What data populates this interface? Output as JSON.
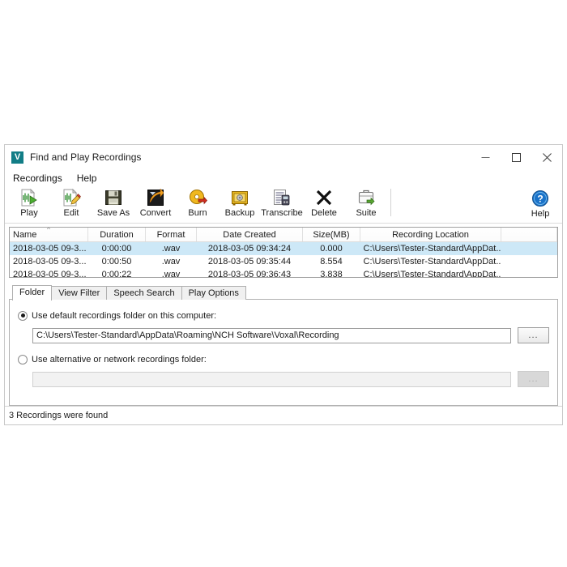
{
  "window": {
    "title": "Find and Play Recordings",
    "app_icon": "voxal-v-icon",
    "icon_letter": "V",
    "icon_color": "#127d86",
    "controls": {
      "minimize": "minimize-icon",
      "maximize": "maximize-icon",
      "close": "close-icon"
    }
  },
  "menubar": {
    "items": [
      {
        "label": "Recordings"
      },
      {
        "label": "Help"
      }
    ]
  },
  "toolbar": {
    "buttons": [
      {
        "label": "Play",
        "icon": "play-waveform-icon"
      },
      {
        "label": "Edit",
        "icon": "edit-waveform-icon"
      },
      {
        "label": "Save As",
        "icon": "floppy-disk-icon"
      },
      {
        "label": "Convert",
        "icon": "convert-arrow-icon"
      },
      {
        "label": "Burn",
        "icon": "burn-disc-icon"
      },
      {
        "label": "Backup",
        "icon": "safe-vault-icon"
      },
      {
        "label": "Transcribe",
        "icon": "transcribe-icon"
      },
      {
        "label": "Delete",
        "icon": "delete-x-icon"
      },
      {
        "label": "Suite",
        "icon": "suite-briefcase-icon"
      }
    ],
    "help": {
      "label": "Help",
      "icon": "help-question-icon"
    }
  },
  "recordings_table": {
    "columns": [
      "Name",
      "Duration",
      "Format",
      "Date Created",
      "Size(MB)",
      "Recording Location"
    ],
    "sort_column": "Name",
    "sort_direction": "ascending",
    "sort_glyph": "▲",
    "rows": [
      {
        "name": "2018-03-05 09-3...",
        "duration": "0:00:00",
        "format": ".wav",
        "date_created": "2018-03-05 09:34:24",
        "size_mb": "0.000",
        "location": "C:\\Users\\Tester-Standard\\AppDat...",
        "selected": true
      },
      {
        "name": "2018-03-05 09-3...",
        "duration": "0:00:50",
        "format": ".wav",
        "date_created": "2018-03-05 09:35:44",
        "size_mb": "8.554",
        "location": "C:\\Users\\Tester-Standard\\AppDat...",
        "selected": false
      },
      {
        "name": "2018-03-05 09-3...",
        "duration": "0:00:22",
        "format": ".wav",
        "date_created": "2018-03-05 09:36:43",
        "size_mb": "3.838",
        "location": "C:\\Users\\Tester-Standard\\AppDat...",
        "selected": false
      }
    ]
  },
  "tabs": [
    {
      "label": "Folder",
      "active": true
    },
    {
      "label": "View Filter",
      "active": false
    },
    {
      "label": "Speech Search",
      "active": false
    },
    {
      "label": "Play Options",
      "active": false
    }
  ],
  "folder_panel": {
    "default_option": {
      "label": "Use default recordings folder on this computer:",
      "selected": true,
      "path_value": "C:\\Users\\Tester-Standard\\AppData\\Roaming\\NCH Software\\Voxal\\Recording",
      "browse_label": "...",
      "browse_enabled": true
    },
    "alternative_option": {
      "label": "Use alternative or network recordings folder:",
      "selected": false,
      "path_value": "",
      "browse_label": "...",
      "browse_enabled": false
    }
  },
  "statusbar": {
    "text": "3 Recordings were found"
  },
  "colors": {
    "selection": "#cde8f7",
    "accent": "#127d86",
    "window_bg": "#ffffff"
  }
}
